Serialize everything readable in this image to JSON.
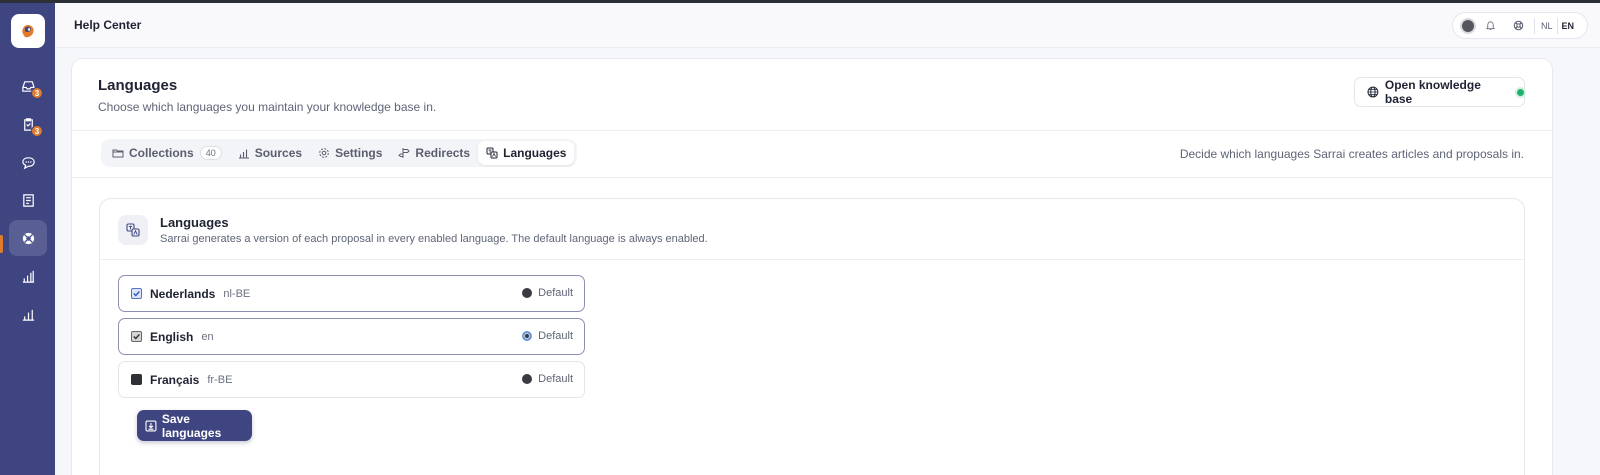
{
  "header": {
    "title": "Help Center",
    "languages": [
      "NL",
      "EN"
    ],
    "active_language": "EN"
  },
  "sidebar": {
    "items": [
      {
        "icon": "inbox-icon",
        "badge": "3"
      },
      {
        "icon": "clipboard-icon",
        "badge": "3"
      },
      {
        "icon": "chat-icon"
      },
      {
        "icon": "document-icon"
      },
      {
        "icon": "lifebuoy-icon",
        "active": true
      },
      {
        "icon": "bar-chart-icon"
      },
      {
        "icon": "bar-chart-icon"
      }
    ]
  },
  "page": {
    "title": "Languages",
    "subtitle": "Choose which languages you maintain your knowledge base in.",
    "open_kb_label": "Open knowledge base"
  },
  "tabs": {
    "items": [
      {
        "label": "Collections",
        "count": "40"
      },
      {
        "label": "Sources"
      },
      {
        "label": "Settings"
      },
      {
        "label": "Redirects"
      },
      {
        "label": "Languages",
        "active": true
      }
    ],
    "hint": "Decide which languages Sarrai creates articles and proposals in."
  },
  "panel": {
    "title": "Languages",
    "description": "Sarrai generates a version of each proposal in every enabled language. The default language is always enabled.",
    "languages": [
      {
        "name": "Nederlands",
        "code": "nl-BE",
        "checked": true,
        "default_label": "Default"
      },
      {
        "name": "English",
        "code": "en",
        "checked": true,
        "default_label": "Default",
        "is_default": true
      },
      {
        "name": "Français",
        "code": "fr-BE",
        "checked": false,
        "default_label": "Default"
      }
    ],
    "save_label": "Save languages"
  },
  "colors": {
    "sidebar": "#3e4580",
    "accent": "#3e4580",
    "badge": "#e07b2c",
    "status_online": "#1fb26c"
  }
}
